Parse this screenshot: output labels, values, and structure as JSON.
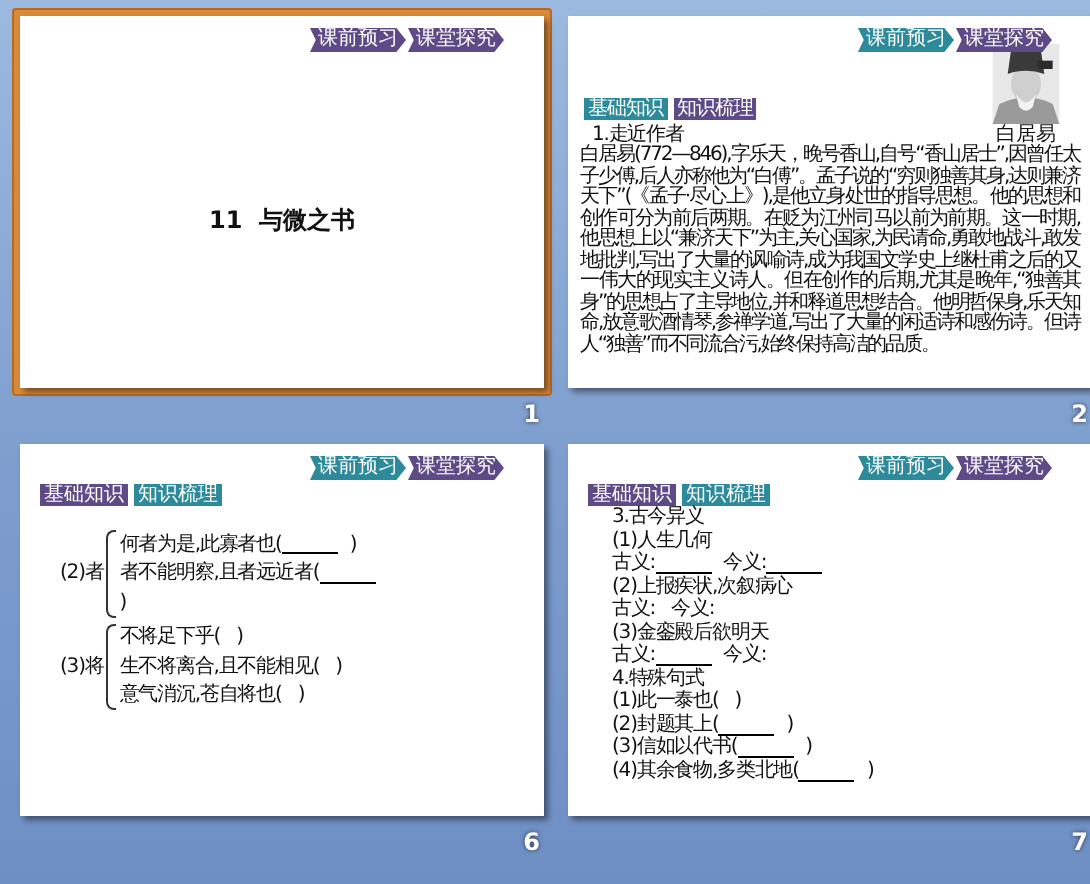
{
  "slides": [
    {
      "number": "1",
      "selected": true,
      "kind": "title",
      "nav": [
        {
          "label": "课前预习",
          "color": "#5e4a86"
        },
        {
          "label": "课堂探究",
          "color": "#5e4a86"
        }
      ],
      "title": "11  与微之书"
    },
    {
      "number": "2",
      "selected": false,
      "kind": "author",
      "nav": [
        {
          "label": "课前预习",
          "color": "#2d8a9a"
        },
        {
          "label": "课堂探究",
          "color": "#5e4a86"
        }
      ],
      "tags": [
        {
          "label": "基础知识",
          "color": "#2d8a9a"
        },
        {
          "label": "知识梳理",
          "color": "#5e4a86"
        }
      ],
      "heading": "1.走近作者",
      "paragraph": "白居易(772—846),字乐天，晚号香山,自号“香山居士”,因曾任太子少傅,后人亦称他为“白傅”。孟子说的“穷则独善其身,达则兼济天下”(《孟子·尽心上》),是他立身处世的指导思想。他的思想和创作可分为前后两期。在贬为江州司马以前为前期。这一时期,他思想上以“兼济天下”为主,关心国家,为民请命,勇敢地战斗,敢发地批判,写出了大量的讽喻诗,成为我国文学史上继杜甫之后的又一伟大的现实主义诗人。但在创作的后期,尤其是晚年,“独善其身”的思想占了主导地位,并和释道思想结合。他明哲保身,乐天知命,放意歌酒情琴,参禅学道,写出了大量的闲适诗和感伤诗。但诗人“独善”而不同流合污,始终保持高洁的品质。",
      "caption": "白居易"
    },
    {
      "number": "6",
      "selected": false,
      "kind": "brace",
      "nav": [
        {
          "label": "课前预习",
          "color": "#2d8a9a"
        },
        {
          "label": "课堂探究",
          "color": "#5e4a86"
        }
      ],
      "tags": [
        {
          "label": "基础知识",
          "color": "#5e4a86"
        },
        {
          "label": "知识梳理",
          "color": "#2d8a9a"
        }
      ],
      "groups": [
        {
          "label": "(2)者",
          "lines": [
            [
              {
                "text": "何者为是,此寡者也(",
                "blank": true
              },
              {
                "text": ")",
                "blank": false
              }
            ],
            [
              {
                "text": "者不能明察,且者远近者(",
                "blank": true
              }
            ],
            [
              {
                "text": ")",
                "blank": false
              }
            ]
          ]
        },
        {
          "label": "(3)将",
          "lines": [
            [
              {
                "text": "不将足下乎(",
                "blank": false
              },
              {
                "text": ")",
                "blank": false
              }
            ],
            [
              {
                "text": "生不将离合,且不能相见(",
                "blank": false
              },
              {
                "text": ")",
                "blank": false
              }
            ],
            [
              {
                "text": "意气消沉,苍自将也(",
                "blank": false
              },
              {
                "text": ")",
                "blank": false
              }
            ]
          ]
        }
      ]
    },
    {
      "number": "7",
      "selected": false,
      "kind": "lines",
      "nav": [
        {
          "label": "课前预习",
          "color": "#2d8a9a"
        },
        {
          "label": "课堂探究",
          "color": "#5e4a86"
        }
      ],
      "tags": [
        {
          "label": "基础知识",
          "color": "#5e4a86"
        },
        {
          "label": "知识梳理",
          "color": "#2d8a9a"
        }
      ],
      "lines": [
        [
          {
            "text": "3.古今异义",
            "blank": false
          }
        ],
        [
          {
            "text": "(1)人生几何",
            "blank": false
          }
        ],
        [
          {
            "text": "古义:",
            "blank": true
          },
          {
            "text": "今义:",
            "blank": true
          }
        ],
        [
          {
            "text": "(2)上报疾状,次叙病心",
            "blank": false
          }
        ],
        [
          {
            "text": "古义:",
            "blank": false
          },
          {
            "text": "今义:",
            "blank": false
          }
        ],
        [
          {
            "text": "(3)金銮殿后欲明天",
            "blank": false
          }
        ],
        [
          {
            "text": "古义:",
            "blank": true
          },
          {
            "text": "今义:",
            "blank": false
          }
        ],
        [
          {
            "text": "4.特殊句式",
            "blank": false
          }
        ],
        [
          {
            "text": "(1)此一泰也(",
            "blank": false
          },
          {
            "text": ")",
            "blank": false
          }
        ],
        [
          {
            "text": "(2)封题其上(",
            "blank": true
          },
          {
            "text": ")",
            "blank": false
          }
        ],
        [
          {
            "text": "(3)信如以代书(",
            "blank": true
          },
          {
            "text": ")",
            "blank": false
          }
        ],
        [
          {
            "text": "(4)其余食物,多类北地(",
            "blank": true
          },
          {
            "text": ")",
            "blank": false
          }
        ]
      ]
    }
  ]
}
